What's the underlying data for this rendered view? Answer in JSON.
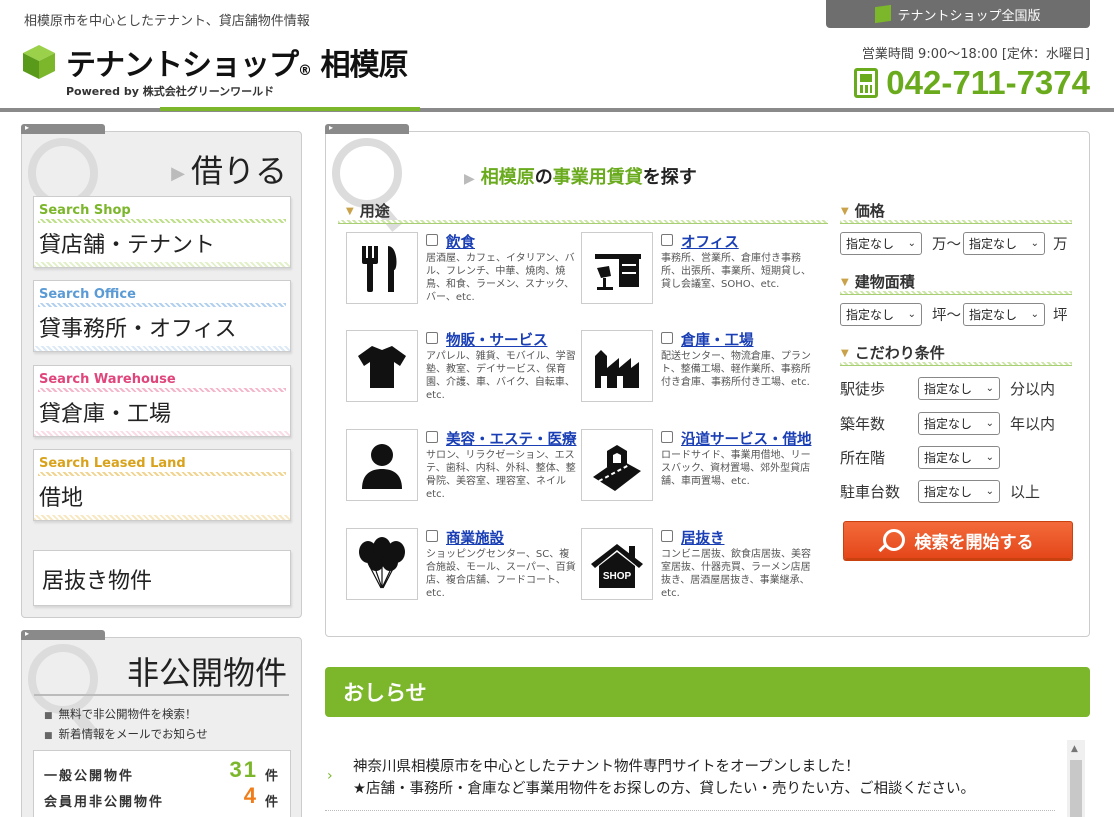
{
  "header": {
    "tagline": "相模原市を中心としたテナント、貸店舗物件情報",
    "logo_main": "テナントショップ",
    "logo_reg": "®",
    "logo_area": "相模原",
    "logo_sub": "Powered by 株式会社グリーンワールド",
    "national_button": "テナントショップ全国版",
    "hours": "営業時間 9:00～18:00 [定休：水曜日]",
    "phone": "042-711-7374"
  },
  "rent_panel": {
    "heading": "借りる",
    "categories": [
      {
        "en": "Search Shop",
        "jp": "貸店舗・テナント",
        "color": "#7bb62b"
      },
      {
        "en": "Search Office",
        "jp": "貸事務所・オフィス",
        "color": "#5b9bd5"
      },
      {
        "en": "Search Warehouse",
        "jp": "貸倉庫・工場",
        "color": "#e0457b"
      },
      {
        "en": "Search Leased Land",
        "jp": "借地",
        "color": "#d9a21b"
      }
    ],
    "inuki": "居抜き物件"
  },
  "private_panel": {
    "heading": "非公開物件",
    "bullets": [
      "無料で非公開物件を検索！",
      "新着情報をメールでお知らせ"
    ],
    "public_label": "一般公開物件",
    "public_count": "31",
    "member_label": "会員用非公開物件",
    "member_count": "4",
    "unit": "件"
  },
  "search": {
    "title_area": "相模原",
    "title_no": "の",
    "title_type": "事業用賃貸",
    "title_tail": "を探す",
    "use_label": "用途",
    "uses": [
      {
        "title": "飲食",
        "desc": "居酒屋、カフェ、イタリアン、バル、フレンチ、中華、焼肉、焼鳥、和食、ラーメン、スナック、バー、etc.",
        "icon": "fork-knife-icon"
      },
      {
        "title": "オフィス",
        "desc": "事務所、営業所、倉庫付き事務所、出張所、事業所、短期貸し、貸し会議室、SOHO、etc.",
        "icon": "office-desk-icon"
      },
      {
        "title": "物販・サービス",
        "desc": "アパレル、雑貨、モバイル、学習塾、教室、デイサービス、保育園、介護、車、バイク、自転車、etc.",
        "icon": "tshirt-icon"
      },
      {
        "title": "倉庫・工場",
        "desc": "配送センター、物流倉庫、プラント、整備工場、軽作業所、事務所付き倉庫、事務所付き工場、etc.",
        "icon": "factory-icon"
      },
      {
        "title": "美容・エステ・医療",
        "desc": "サロン、リラクゼーション、エステ、歯科、内科、外科、整体、整骨院、美容室、理容室、ネイル etc.",
        "icon": "person-icon"
      },
      {
        "title": "沿道サービス・借地",
        "desc": "ロードサイド、事業用借地、リースバック、資材置場、郊外型貸店舗、車両置場、etc.",
        "icon": "roadside-icon"
      },
      {
        "title": "商業施設",
        "desc": "ショッピングセンター、SC、複合施設、モール、スーパー、百貨店、複合店舗、フードコート、etc.",
        "icon": "balloons-icon"
      },
      {
        "title": "居抜き",
        "desc": "コンビニ居抜、飲食店居抜、美容室居抜、什器売買、ラーメン店居抜き、居酒屋居抜き、事業継承、etc.",
        "icon": "shop-house-icon"
      }
    ],
    "shop_label": "SHOP",
    "price_label": "価格",
    "price_unit_from": "万～",
    "price_unit_to": "万",
    "area_label": "建物面積",
    "area_unit_from": "坪～",
    "area_unit_to": "坪",
    "cond_label": "こだわり条件",
    "default_option": "指定なし",
    "conditions": [
      {
        "label": "駅徒歩",
        "unit": "分以内"
      },
      {
        "label": "築年数",
        "unit": "年以内"
      },
      {
        "label": "所在階",
        "unit": ""
      },
      {
        "label": "駐車台数",
        "unit": "以上"
      }
    ],
    "search_button": "検索を開始する"
  },
  "news": {
    "heading": "おしらせ",
    "line1": "神奈川県相模原市を中心としたテナント物件専門サイトをオープンしました！",
    "line2": "★店舗・事務所・倉庫など事業用物件をお探しの方、貸したい・売りたい方、ご相談ください。"
  }
}
